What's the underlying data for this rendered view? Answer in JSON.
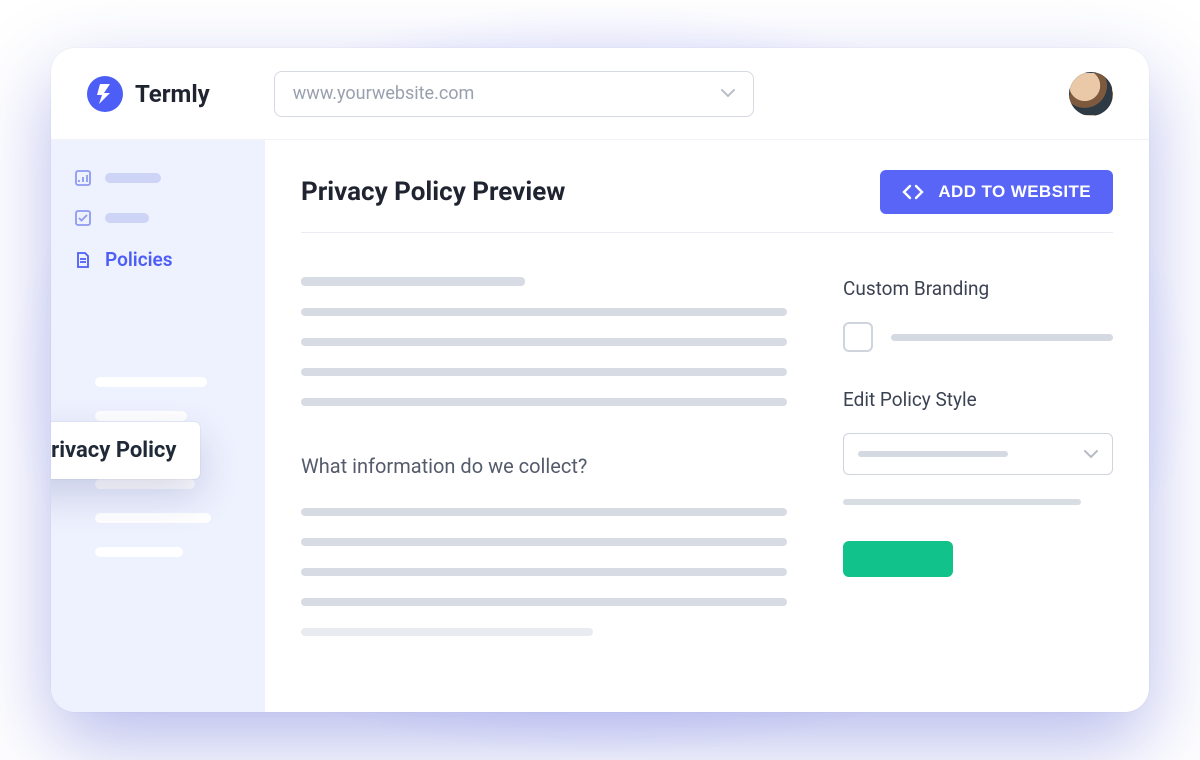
{
  "brand": {
    "name": "Termly"
  },
  "header": {
    "site_selector_value": "www.yourwebsite.com"
  },
  "sidebar": {
    "items": [
      {
        "icon": "chart",
        "label": ""
      },
      {
        "icon": "check",
        "label": ""
      },
      {
        "icon": "doc",
        "label": "Policies",
        "active": true
      }
    ],
    "current_policy_label": "Privacy Policy"
  },
  "main": {
    "page_title": "Privacy Policy Preview",
    "add_button_label": "ADD TO WEBSITE",
    "preview_section_heading": "What information do we collect?"
  },
  "right_panel": {
    "branding_heading": "Custom Branding",
    "style_heading": "Edit Policy Style"
  },
  "colors": {
    "accent": "#4d5ef7",
    "button_green": "#11c28b"
  }
}
